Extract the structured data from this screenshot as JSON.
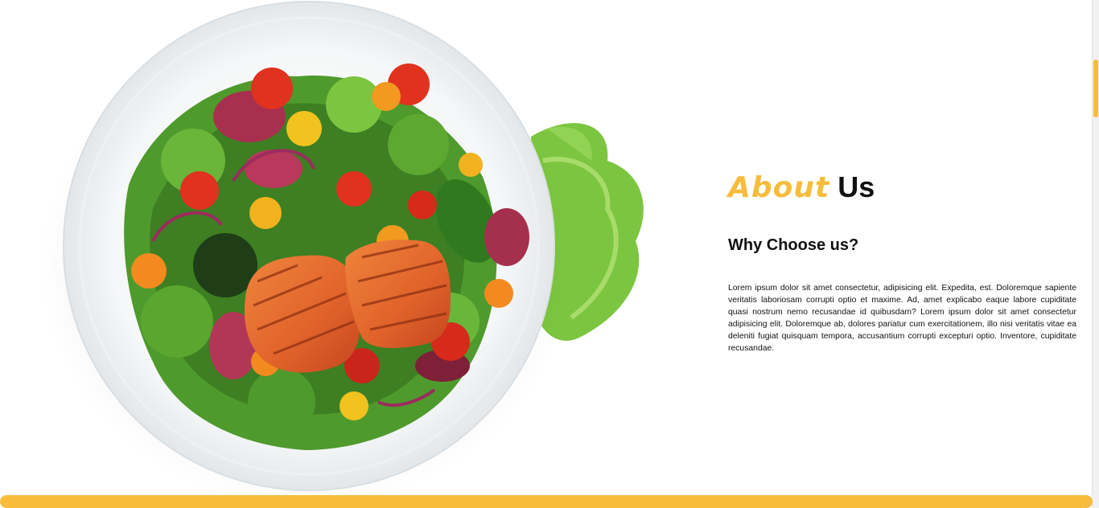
{
  "about": {
    "title_accent": "About",
    "title_rest": "Us",
    "subtitle": "Why Choose us?",
    "body": "Lorem ipsum dolor sit amet consectetur, adipisicing elit. Expedita, est. Doloremque sapiente veritatis laboriosam corrupti optio et maxime. Ad, amet explicabo eaque labore cupiditate quasi nostrum nemo recusandae id quibusdam? Lorem ipsum dolor sit amet consectetur adipisicing elit. Doloremque ab, dolores pariatur cum exercitationem, illo nisi veritatis vitae ea deleniti fugiat quisquam tempora, accusantium corrupti excepturi optio. Inventore, cupiditate recusandae."
  },
  "image": {
    "subject": "salmon-salad-plate"
  },
  "colors": {
    "accent": "#f7bc3b",
    "text": "#111111",
    "background": "#ffffff"
  }
}
